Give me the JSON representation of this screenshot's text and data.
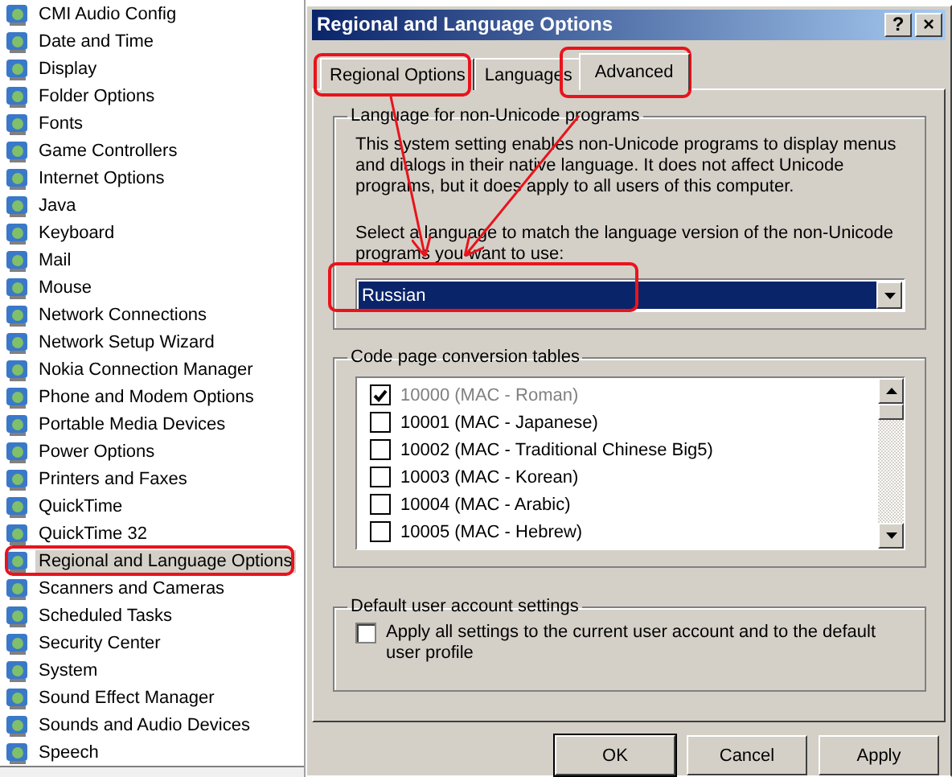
{
  "control_panel": {
    "items": [
      {
        "label": "CMI Audio Config",
        "selected": false
      },
      {
        "label": "Date and Time",
        "selected": false
      },
      {
        "label": "Display",
        "selected": false
      },
      {
        "label": "Folder Options",
        "selected": false
      },
      {
        "label": "Fonts",
        "selected": false
      },
      {
        "label": "Game Controllers",
        "selected": false
      },
      {
        "label": "Internet Options",
        "selected": false
      },
      {
        "label": "Java",
        "selected": false
      },
      {
        "label": "Keyboard",
        "selected": false
      },
      {
        "label": "Mail",
        "selected": false
      },
      {
        "label": "Mouse",
        "selected": false
      },
      {
        "label": "Network Connections",
        "selected": false
      },
      {
        "label": "Network Setup Wizard",
        "selected": false
      },
      {
        "label": "Nokia Connection Manager",
        "selected": false
      },
      {
        "label": "Phone and Modem Options",
        "selected": false
      },
      {
        "label": "Portable Media Devices",
        "selected": false
      },
      {
        "label": "Power Options",
        "selected": false
      },
      {
        "label": "Printers and Faxes",
        "selected": false
      },
      {
        "label": "QuickTime",
        "selected": false
      },
      {
        "label": "QuickTime 32",
        "selected": false
      },
      {
        "label": "Regional and Language Options",
        "selected": true
      },
      {
        "label": "Scanners and Cameras",
        "selected": false
      },
      {
        "label": "Scheduled Tasks",
        "selected": false
      },
      {
        "label": "Security Center",
        "selected": false
      },
      {
        "label": "System",
        "selected": false
      },
      {
        "label": "Sound Effect Manager",
        "selected": false
      },
      {
        "label": "Sounds and Audio Devices",
        "selected": false
      },
      {
        "label": "Speech",
        "selected": false
      }
    ]
  },
  "dialog": {
    "title": "Regional and Language Options",
    "help_button": "?",
    "close_button": "×",
    "tabs": [
      {
        "label": "Regional Options",
        "selected": false
      },
      {
        "label": "Languages",
        "selected": false
      },
      {
        "label": "Advanced",
        "selected": true
      }
    ],
    "non_unicode_group": {
      "title": "Language for non-Unicode programs",
      "description": "This system setting enables non-Unicode programs to display menus and dialogs in their native language. It does not affect Unicode programs, but it does apply to all users of this computer.",
      "prompt": "Select a language to match the language version of the non-Unicode programs you want to use:",
      "language": "Russian"
    },
    "code_page_group": {
      "title": "Code page conversion tables",
      "rows": [
        {
          "label": "10000 (MAC - Roman)",
          "checked": true,
          "disabled": true
        },
        {
          "label": "10001 (MAC - Japanese)",
          "checked": false,
          "disabled": false
        },
        {
          "label": "10002 (MAC - Traditional Chinese Big5)",
          "checked": false,
          "disabled": false
        },
        {
          "label": "10003 (MAC - Korean)",
          "checked": false,
          "disabled": false
        },
        {
          "label": "10004 (MAC - Arabic)",
          "checked": false,
          "disabled": false
        },
        {
          "label": "10005 (MAC - Hebrew)",
          "checked": false,
          "disabled": false
        }
      ]
    },
    "default_user_group": {
      "title": "Default user account settings",
      "option": {
        "label": "Apply all settings to the current user account and to the default user profile",
        "checked": false
      }
    },
    "buttons": [
      {
        "label": "OK",
        "default": true
      },
      {
        "label": "Cancel",
        "default": false
      },
      {
        "label": "Apply",
        "default": false
      }
    ]
  }
}
